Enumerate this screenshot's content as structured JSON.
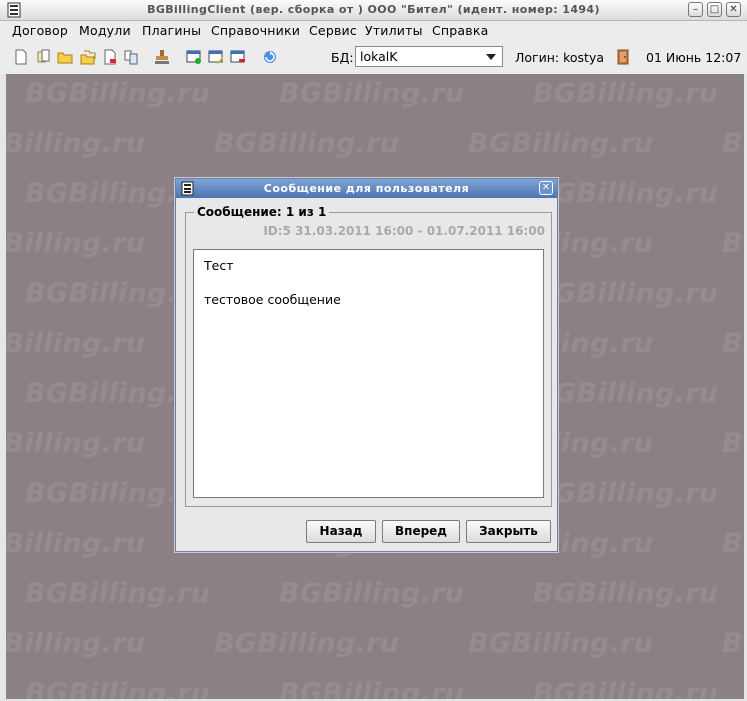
{
  "window": {
    "title": "BGBillingClient (вер.  сборка  от ) ООО \"Бител\" (идент. номер: 1494)",
    "minimize": "–",
    "maximize": "□",
    "close": "✕"
  },
  "menu": [
    "Договор",
    "Модули",
    "Плагины",
    "Справочники",
    "Сервис",
    "Утилиты",
    "Справка"
  ],
  "toolbar": {
    "icons": [
      "new-document-icon",
      "copy-document-icon",
      "open-folder-icon",
      "folders-icon",
      "document-delete-icon",
      "documents-icon",
      "stamp-icon",
      "window-add-icon",
      "window-edit-icon",
      "window-remove-icon",
      "refresh-icon"
    ],
    "db_label": "БД:",
    "db_value": "lokalK",
    "login_label": "Логин: kostya",
    "datetime": "01 Июнь 12:07"
  },
  "watermark": "BGBilling.ru",
  "dialog": {
    "title": "Сообщение для пользователя",
    "close": "✕",
    "group_label": "Сообщение: 1 из 1",
    "meta": "ID:5   31.03.2011 16:00 - 01.07.2011 16:00",
    "message_title": "Тест",
    "message_body": "тестовое сообщение",
    "buttons": {
      "back": "Назад",
      "forward": "Вперед",
      "close": "Закрыть"
    }
  },
  "colors": {
    "desktop": "#8b8184",
    "watermark": "#968c8f",
    "dialog_title": "#5a80bb"
  }
}
